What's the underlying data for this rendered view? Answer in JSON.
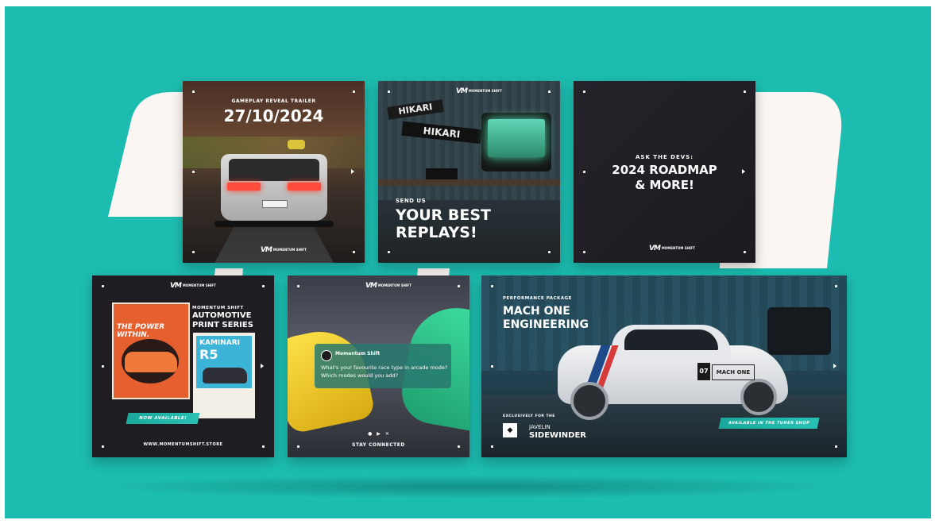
{
  "cards": {
    "trailer": {
      "kicker": "GAMEPLAY REVEAL TRAILER",
      "date": "27/10/2024"
    },
    "replays": {
      "sign_top": "HIKARI",
      "sign_bottom": "HIKARI",
      "kicker": "SEND US",
      "title_line1": "YOUR BEST",
      "title_line2": "REPLAYS!"
    },
    "roadmap": {
      "kicker": "ASK THE DEVS:",
      "title_line1": "2024 ROADMAP",
      "title_line2": "& MORE!"
    },
    "print": {
      "brand": "MOMENTUM SHIFT",
      "title_line1": "AUTOMOTIVE",
      "title_line2": "PRINT SERIES",
      "poster1_title": "THE POWER WITHIN.",
      "poster2_title_line1": "KAMINARI",
      "poster2_title_line2": "R5",
      "button": "NOW AVAILABLE!",
      "url": "WWW.MOMENTUMSHIFT.STORE"
    },
    "social": {
      "account": "Momentum Shift",
      "question_line1": "What's your favourite race type in arcade mode?",
      "question_line2": "Which modes would you add?",
      "footer": "STAY CONNECTED"
    },
    "package": {
      "kicker": "PERFORMANCE PACKAGE",
      "title_line1": "MACH ONE",
      "title_line2": "ENGINEERING",
      "door_number": "07",
      "door_brand": "MACH ONE",
      "exclusive": "EXCLUSIVELY FOR THE",
      "car_line1": "JAVELIN",
      "car_line2": "SIDEWINDER",
      "button": "AVAILABLE IN THE TUNER SHOP"
    }
  },
  "colors": {
    "background": "#1dbcb0",
    "accent": "#29c1b4",
    "mark": "#fbf6f3"
  }
}
